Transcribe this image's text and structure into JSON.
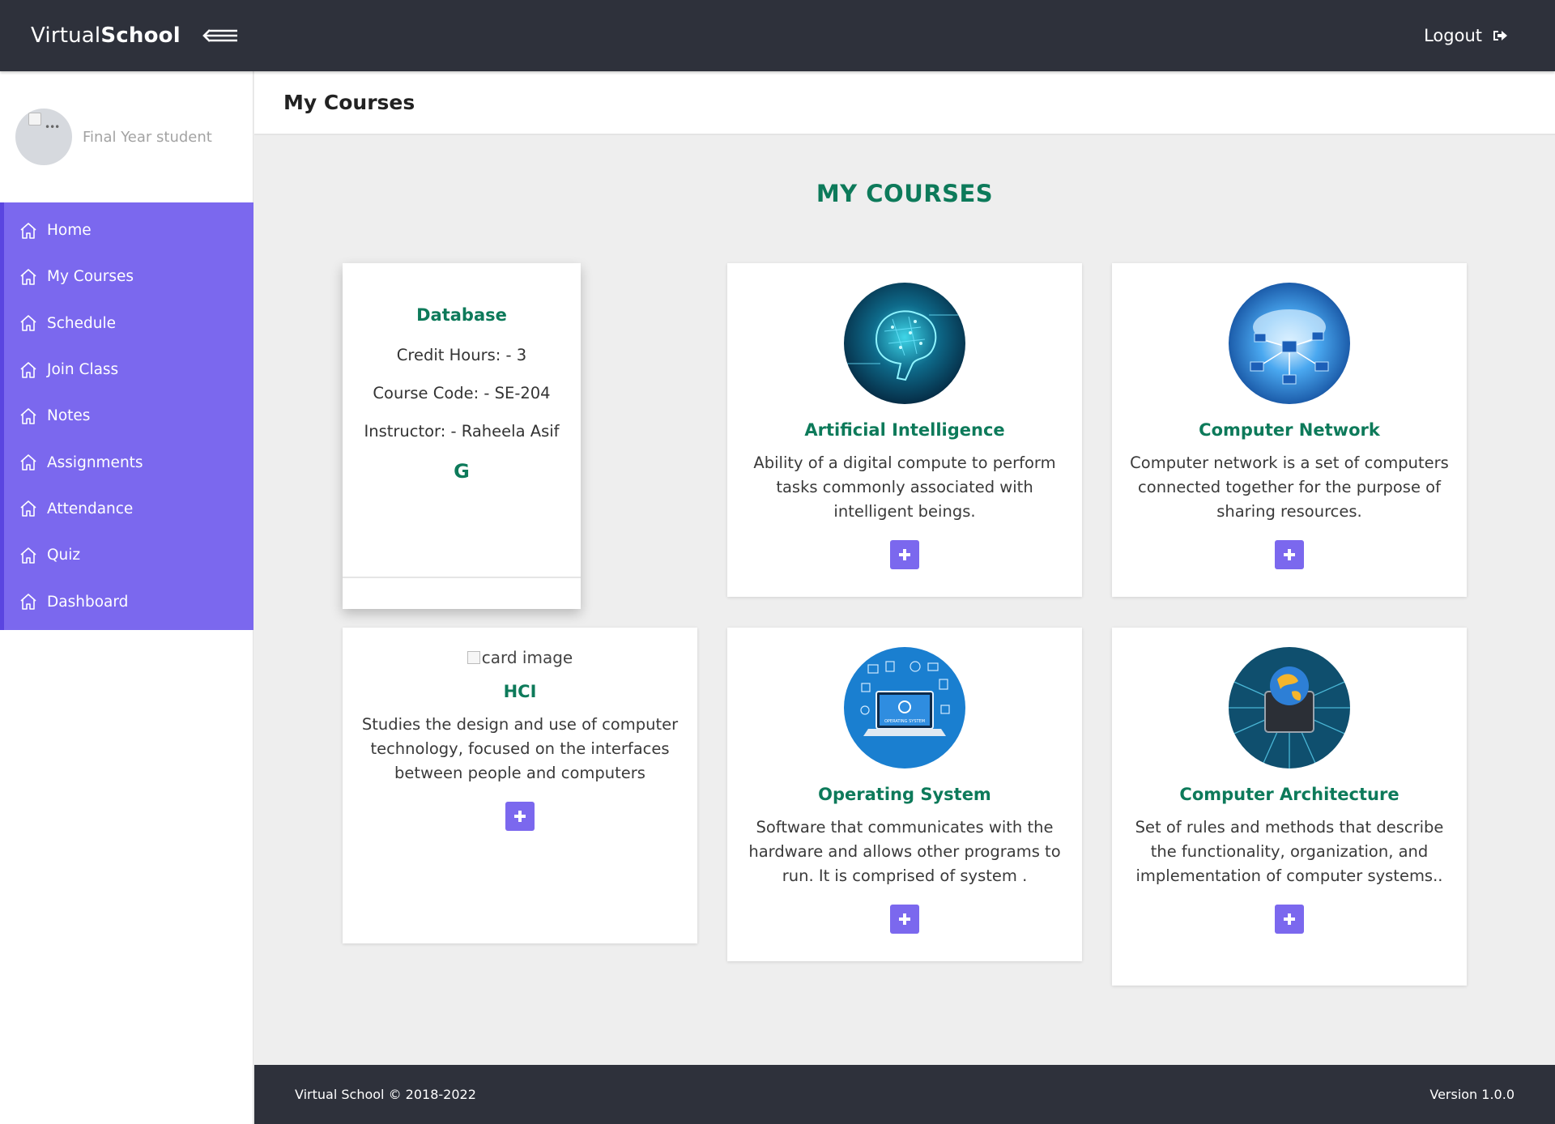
{
  "brand": {
    "prefix": "Virtual",
    "suffix": "School"
  },
  "topbar": {
    "logout_label": "Logout"
  },
  "profile": {
    "role": "Final Year student"
  },
  "sidebar": {
    "items": [
      {
        "label": "Home",
        "icon": "home-icon"
      },
      {
        "label": "My Courses",
        "icon": "home-icon"
      },
      {
        "label": "Schedule",
        "icon": "home-icon"
      },
      {
        "label": "Join Class",
        "icon": "home-icon"
      },
      {
        "label": "Notes",
        "icon": "home-icon"
      },
      {
        "label": "Assignments",
        "icon": "home-icon"
      },
      {
        "label": "Attendance",
        "icon": "home-icon"
      },
      {
        "label": "Quiz",
        "icon": "home-icon"
      },
      {
        "label": "Dashboard",
        "icon": "home-icon"
      }
    ]
  },
  "page": {
    "title": "My Courses",
    "section_title": "MY COURSES"
  },
  "courses": {
    "database": {
      "title": "Database",
      "credit": "Credit Hours: - 3",
      "code": "Course Code: - SE-204",
      "instructor": "Instructor: - Raheela Asif",
      "letter": "G"
    },
    "ai": {
      "title": "Artificial Intelligence",
      "desc": "Ability of a digital compute to perform tasks commonly associated with intelligent beings."
    },
    "cn": {
      "title": "Computer Network",
      "desc": "Computer network is a set of computers connected together for the purpose of sharing resources."
    },
    "hci": {
      "image_alt": "card image",
      "title": "HCI",
      "desc": "Studies the design and use of computer technology, focused on the interfaces between people and computers"
    },
    "os": {
      "title": "Operating System",
      "desc": "Software that communicates with the hardware and allows other programs to run. It is comprised of system .",
      "screen_text": "OPERATING SYSTEM"
    },
    "ca": {
      "title": "Computer Architecture",
      "desc": "Set of rules and methods that describe the functionality, organization, and implementation of computer systems.."
    }
  },
  "footer": {
    "copyright": "Virtual School © 2018-2022",
    "version": "Version 1.0.0"
  },
  "colors": {
    "accent": "#7b68ee",
    "title_green": "#0d7a5a",
    "topbar": "#2e313b"
  }
}
